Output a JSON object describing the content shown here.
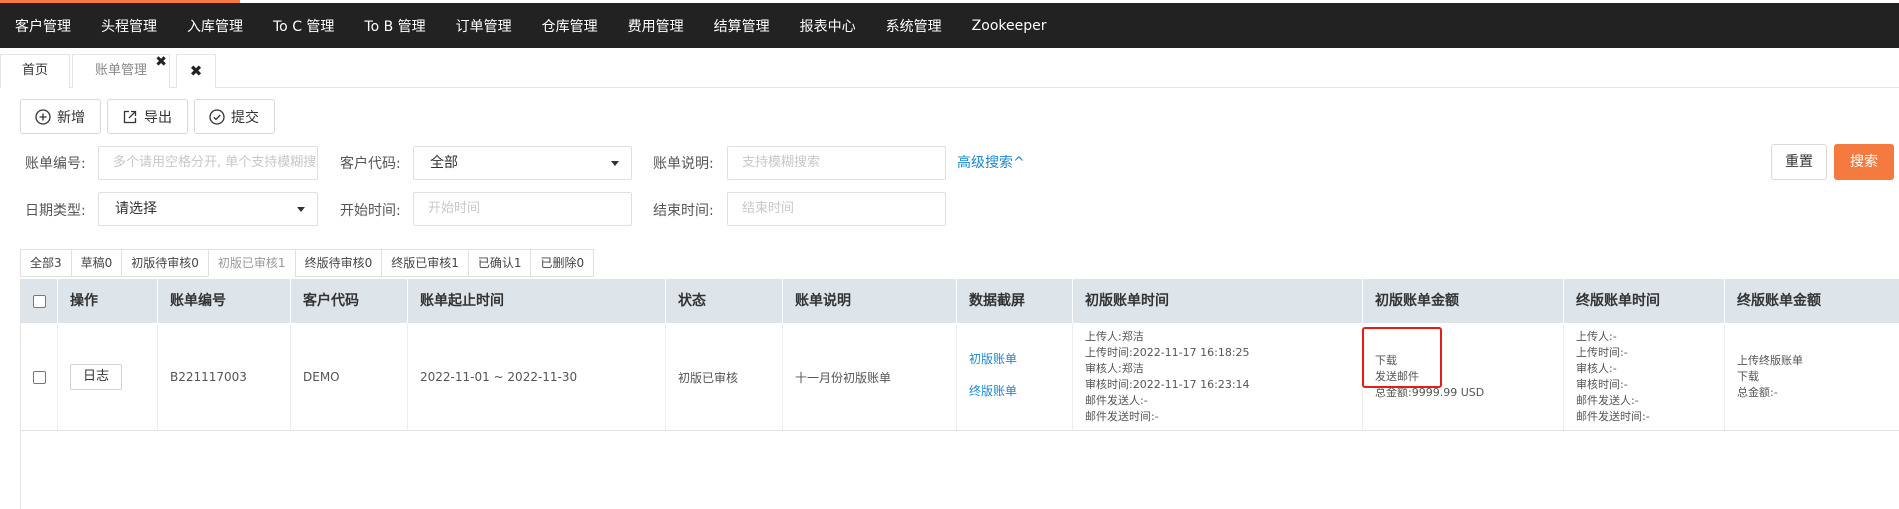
{
  "topnav": {
    "items": [
      "客户管理",
      "头程管理",
      "入库管理",
      "To C 管理",
      "To B 管理",
      "订单管理",
      "仓库管理",
      "费用管理",
      "结算管理",
      "报表中心",
      "系统管理",
      "Zookeeper"
    ]
  },
  "tabs": {
    "home": "首页",
    "bill": "账单管理",
    "bill_close": "✖",
    "close_all": "✖"
  },
  "toolbar": {
    "add": "新增",
    "export": "导出",
    "submit": "提交"
  },
  "filters": {
    "bill_no_label": "账单编号:",
    "bill_no_placeholder": "多个请用空格分开, 单个支持模糊搜索",
    "customer_label": "客户代码:",
    "customer_value": "全部",
    "desc_label": "账单说明:",
    "desc_placeholder": "支持模糊搜索",
    "advanced": "高级搜索^",
    "date_type_label": "日期类型:",
    "date_type_value": "请选择",
    "start_label": "开始时间:",
    "start_placeholder": "开始时间",
    "end_label": "结束时间:",
    "end_placeholder": "结束时间",
    "reset": "重置",
    "search": "搜索"
  },
  "status_tabs": [
    "全部3",
    "草稿0",
    "初版待审核0",
    "初版已审核1",
    "终版待审核0",
    "终版已审核1",
    "已确认1",
    "已删除0"
  ],
  "table": {
    "headers": [
      "操作",
      "账单编号",
      "客户代码",
      "账单起止时间",
      "状态",
      "账单说明",
      "数据截屏",
      "初版账单时间",
      "初版账单金额",
      "终版账单时间",
      "终版账单金额"
    ],
    "row": {
      "log_button": "日志",
      "bill_no": "B221117003",
      "customer": "DEMO",
      "period": "2022-11-01 ~ 2022-11-30",
      "status": "初版已审核",
      "desc": "十一月份初版账单",
      "screenshot_links": [
        "初版账单",
        "终版账单"
      ],
      "initial_time": [
        "上传人:郑洁",
        "上传时间:2022-11-17 16:18:25",
        "审核人:郑洁",
        "审核时间:2022-11-17 16:23:14",
        "邮件发送人:-",
        "邮件发送时间:-"
      ],
      "initial_amount": {
        "download": "下载",
        "send_mail": "发送邮件",
        "total": "总金额:9999.99 USD"
      },
      "final_time": [
        "上传人:-",
        "上传时间:-",
        "审核人:-",
        "审核时间:-",
        "邮件发送人:-",
        "邮件发送时间:-"
      ],
      "final_amount": {
        "upload": "上传终版账单",
        "download": "下载",
        "total": "总金额:-"
      }
    }
  },
  "colors": {
    "accent": "#f47a3f",
    "nav_bg": "#222222",
    "link": "#1e88d3",
    "highlight": "#e61b1b",
    "header_bg": "#dde5eb"
  }
}
